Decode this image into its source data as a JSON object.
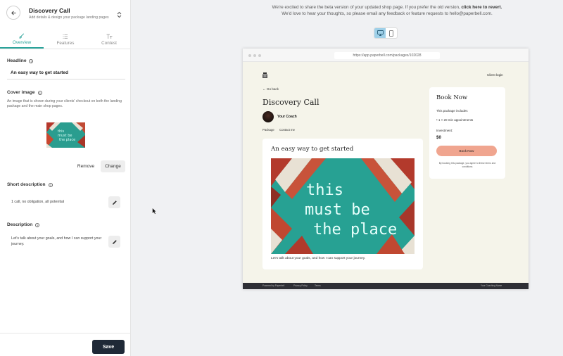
{
  "header": {
    "title": "Discovery Call",
    "subtitle": "Add details & design your package landing pages"
  },
  "tabs": [
    {
      "label": "Overview",
      "active": true
    },
    {
      "label": "Features",
      "active": false
    },
    {
      "label": "Contest",
      "active": false
    }
  ],
  "headline": {
    "label": "Headline",
    "value": "An easy way to get started"
  },
  "cover_image": {
    "label": "Cover image",
    "description": "An image that is shown during your clients' checkout on both the landing package and the main shop pages.",
    "remove_label": "Remove",
    "change_label": "Change"
  },
  "short_description": {
    "label": "Short description",
    "value": "1 call, no obligation, all potential"
  },
  "description": {
    "label": "Description",
    "value": "Let's talk about your goals, and how I can support your journey."
  },
  "footer": {
    "save_label": "Save"
  },
  "notice": {
    "line1": "We're excited to share the beta version of your updated shop page. If you prefer the old version, ",
    "line1_link": "click here to revert.",
    "line2": "We'd love to hear your thoughts, so please email any feedback or feature requests to hello@paperbell.com."
  },
  "preview": {
    "url": "https://app.paperbell.com/packages/102028",
    "client_login": "Client login",
    "go_back": "← Go back",
    "title": "Discovery Call",
    "coach_name": "Your Coach",
    "nav_package": "Package",
    "nav_contact": "Contact me",
    "card_headline": "An easy way to get started",
    "card_description": "Let's talk about your goals, and how I can support your journey.",
    "image_text": [
      "this",
      "must be",
      "the place"
    ],
    "book": {
      "title": "Book Now",
      "includes": "This package includes",
      "item": "•  1 × 20 min appointments",
      "investment_label": "Investment:",
      "price": "$0",
      "button": "Book Now",
      "terms": "By booking this package, you agree to these terms and conditions"
    },
    "footer": {
      "powered": "Powered by Paperbell",
      "privacy": "Privacy Policy",
      "terms": "Terms",
      "practice": "Your Coaching Name"
    }
  },
  "colors": {
    "accent": "#2aa39a",
    "save_button": "#1f2937",
    "book_button": "#f0a58f",
    "site_background": "#f5f4ea",
    "desktop_toggle_active": "#9fd0e8"
  }
}
